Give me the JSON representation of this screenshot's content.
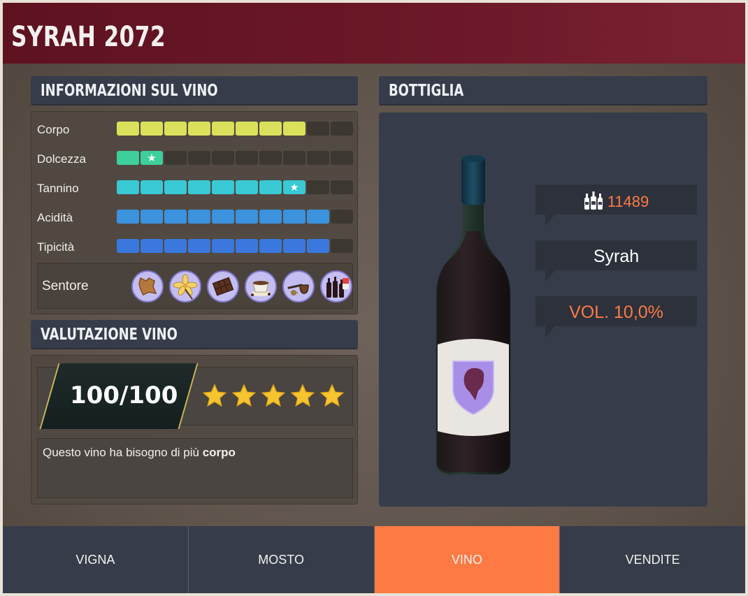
{
  "title": "SYRAH 2072",
  "wine_info": {
    "heading": "INFORMAZIONI SUL VINO",
    "attributes": [
      {
        "label": "Corpo",
        "level": 8,
        "max": 10,
        "color": "#dbe05a",
        "star_at": null
      },
      {
        "label": "Dolcezza",
        "level": 2,
        "max": 10,
        "color": "#3dcf9c",
        "star_at": 2
      },
      {
        "label": "Tannino",
        "level": 8,
        "max": 10,
        "color": "#38c9d4",
        "star_at": 8
      },
      {
        "label": "Acidità",
        "level": 9,
        "max": 10,
        "color": "#3b92dd",
        "star_at": null
      },
      {
        "label": "Tipicità",
        "level": 9,
        "max": 10,
        "color": "#3a78de",
        "star_at": null
      }
    ],
    "aroma_label": "Sentore",
    "aromas": [
      "leather-icon",
      "vanilla-flower-icon",
      "chocolate-icon",
      "coffee-cup-icon",
      "tobacco-pipe-icon",
      "wine-bottles-icon"
    ]
  },
  "rating": {
    "heading": "VALUTAZIONE VINO",
    "score": "100/100",
    "stars": 5,
    "comment_text": "Questo vino ha bisogno di più ",
    "comment_bold": "corpo"
  },
  "bottle": {
    "heading": "BOTTIGLIA",
    "count": "11489",
    "variety": "Syrah",
    "volume": "VOL. 10,0%"
  },
  "tabs": [
    "VIGNA",
    "MOSTO",
    "VINO",
    "VENDITE"
  ],
  "active_tab": "VINO",
  "colors": {
    "accent": "#fd7a43",
    "header": "#6c1828",
    "panel": "#363c49"
  }
}
